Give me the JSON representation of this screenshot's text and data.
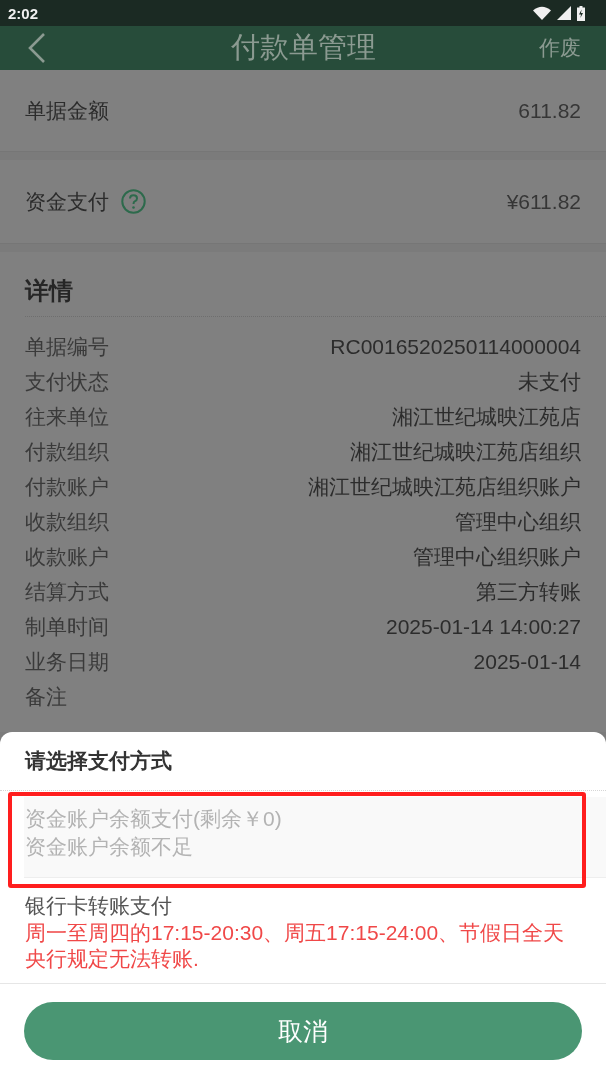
{
  "status_bar": {
    "time": "2:02"
  },
  "header": {
    "title": "付款单管理",
    "action": "作废"
  },
  "summary": [
    {
      "label": "单据金额",
      "value": "611.82",
      "help": false
    },
    {
      "label": "资金支付",
      "value": "¥611.82",
      "help": true
    }
  ],
  "details": {
    "title": "详情",
    "rows": [
      {
        "label": "单据编号",
        "value": "RC0016520250114000004"
      },
      {
        "label": "支付状态",
        "value": "未支付"
      },
      {
        "label": "往来单位",
        "value": "湘江世纪城映江苑店"
      },
      {
        "label": "付款组织",
        "value": "湘江世纪城映江苑店组织"
      },
      {
        "label": "付款账户",
        "value": "湘江世纪城映江苑店组织账户"
      },
      {
        "label": "收款组织",
        "value": "管理中心组织"
      },
      {
        "label": "收款账户",
        "value": "管理中心组织账户"
      },
      {
        "label": "结算方式",
        "value": "第三方转账"
      },
      {
        "label": "制单时间",
        "value": "2025-01-14 14:00:27"
      },
      {
        "label": "业务日期",
        "value": "2025-01-14"
      },
      {
        "label": "备注"
      }
    ]
  },
  "payment_sheet": {
    "title": "请选择支付方式",
    "options": [
      {
        "name": "资金账户余额支付(剩余￥0)",
        "note": "资金账户余额不足",
        "disabled": true,
        "highlighted": true
      },
      {
        "name": "银行卡转账支付",
        "note": "周一至周四的17:15-20:30、周五17:15-24:00、节假日全天央行规定无法转账.",
        "disabled": false,
        "highlighted": false
      }
    ],
    "cancel": "取消"
  }
}
